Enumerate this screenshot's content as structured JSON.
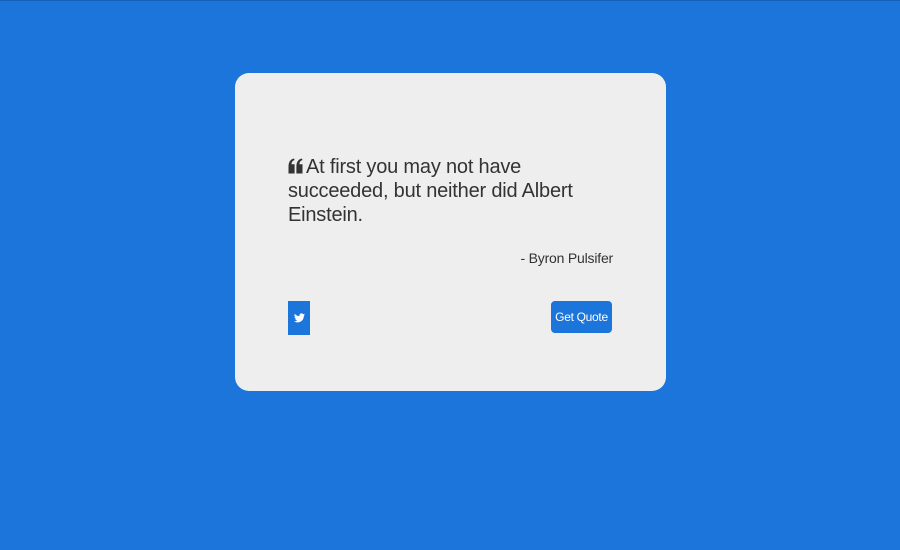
{
  "colors": {
    "background": "#1b75db",
    "card": "#eeeeee",
    "text": "#333333",
    "button": "#1b75db",
    "button_text": "#ffffff"
  },
  "quote": {
    "icon": "quote-left-icon",
    "text": "At first you may not have succeeded, but neither did Albert Einstein.",
    "author": "- Byron Pulsifer"
  },
  "actions": {
    "tweet_icon": "twitter-icon",
    "get_quote_label": "Get Quote"
  }
}
